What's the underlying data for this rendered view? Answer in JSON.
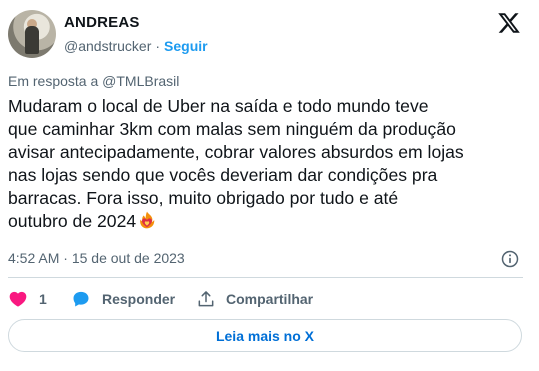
{
  "author": {
    "name": "ANDREAS",
    "handle": "@andstrucker",
    "separator": "·",
    "follow_label": "Seguir"
  },
  "header": {
    "logo_icon": "x-logo-icon"
  },
  "tweet": {
    "reply_to": "Em resposta a @TMLBrasil",
    "text": "Mudaram o local de Uber na saída e todo mundo teve\nque caminhar 3km com malas sem ninguém da produção\navisar antecipadamente, cobrar valores absurdos em lojas\nnas lojas sendo que vocês deveriam dar condições pra\nbarracas. Fora isso, muito obrigado por tudo e até\noutubro de 2024",
    "emoji": "heart-on-fire-emoji",
    "time": "4:52 AM",
    "date_separator": "·",
    "date": "15 de out de 2023"
  },
  "actions": {
    "like_count": "1",
    "reply_label": "Responder",
    "share_label": "Compartilhar"
  },
  "footer": {
    "read_more_label": "Leia mais no X"
  },
  "colors": {
    "accent": "#1d9bf0",
    "like": "#f91880",
    "reply": "#1d9bf0",
    "muted": "#536471"
  }
}
